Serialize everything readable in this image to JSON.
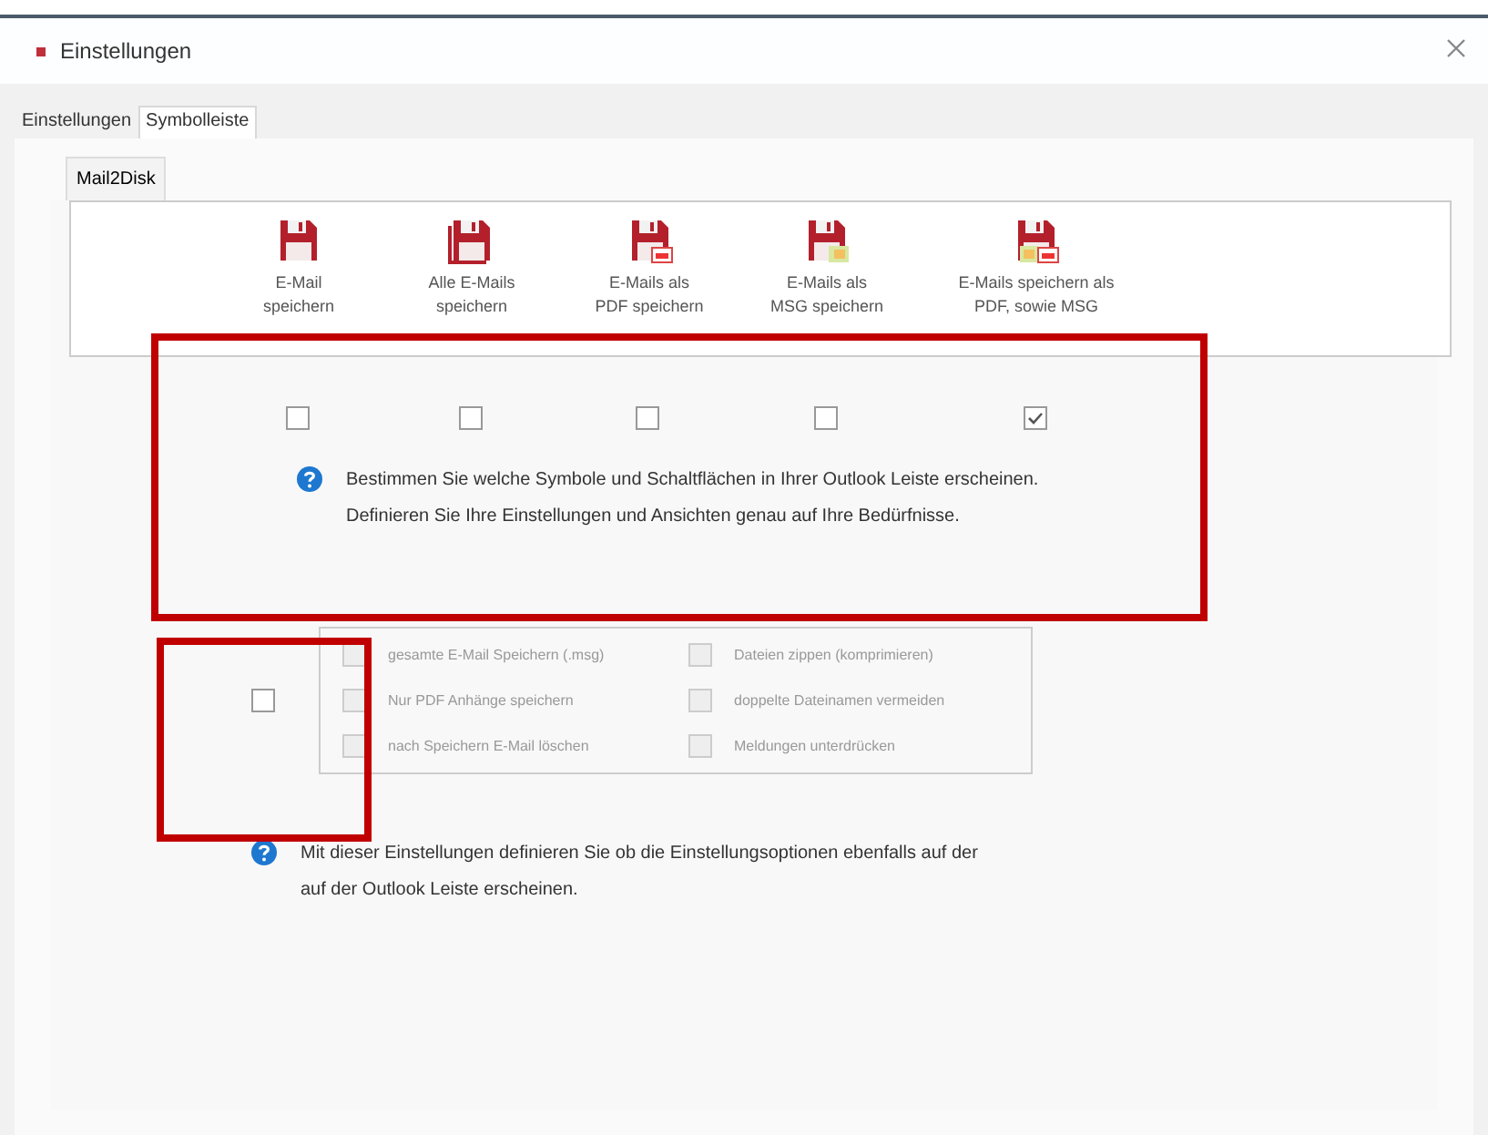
{
  "window": {
    "title": "Einstellungen"
  },
  "tabs": [
    {
      "label": "Einstellungen",
      "selected": false
    },
    {
      "label": "Symbolleiste",
      "selected": true
    }
  ],
  "subtabs": [
    {
      "label": "Mail2Disk",
      "selected": true
    }
  ],
  "toolbar_buttons": [
    {
      "kind": "save",
      "label": "E-Mail\nspeichern",
      "shown": false
    },
    {
      "kind": "save-all",
      "label": "Alle E-Mails\nspeichern",
      "shown": false
    },
    {
      "kind": "pdf",
      "label": "E-Mails als\nPDF speichern",
      "shown": false
    },
    {
      "kind": "msg",
      "label": "E-Mails als\nMSG speichern",
      "shown": false
    },
    {
      "kind": "pdf-msg",
      "label": "E-Mails speichern als\nPDF, sowie MSG",
      "shown": true
    }
  ],
  "info_1": "Bestimmen Sie welche Symbole und Schaltflächen in Ihrer Outlook Leiste erscheinen.\nDefinieren Sie Ihre Einstellungen und Ansichten genau auf Ihre Bedürfnisse.",
  "options_toggle": {
    "checked": false
  },
  "options": [
    {
      "label": "gesamte E-Mail Speichern (.msg)",
      "checked": false,
      "disabled": true
    },
    {
      "label": "Dateien zippen (komprimieren)",
      "checked": false,
      "disabled": true
    },
    {
      "label": "Nur PDF Anhänge speichern",
      "checked": false,
      "disabled": true
    },
    {
      "label": "doppelte Dateinamen vermeiden",
      "checked": false,
      "disabled": true
    },
    {
      "label": "nach Speichern E-Mail löschen",
      "checked": false,
      "disabled": true
    },
    {
      "label": "Meldungen unterdrücken",
      "checked": false,
      "disabled": true
    }
  ],
  "info_2": "Mit dieser Einstellungen definieren Sie ob die Einstellungsoptionen ebenfalls auf der\nauf der Outlook Leiste erscheinen."
}
